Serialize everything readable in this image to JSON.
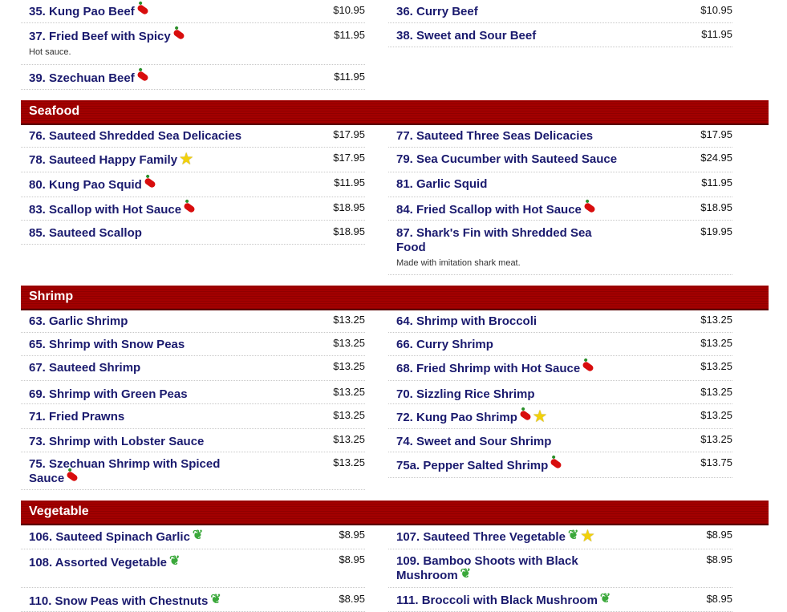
{
  "beef": {
    "items_left": [
      {
        "name": "35. Kung Pao Beef",
        "price": "$10.95",
        "icons": [
          "pepper"
        ],
        "desc": ""
      },
      {
        "name": "37. Fried Beef with Spicy",
        "price": "$11.95",
        "icons": [
          "pepper"
        ],
        "desc": "Hot sauce."
      },
      {
        "name": "39. Szechuan Beef",
        "price": "$11.95",
        "icons": [
          "pepper"
        ],
        "desc": ""
      }
    ],
    "items_right": [
      {
        "name": "36. Curry Beef",
        "price": "$10.95",
        "icons": [],
        "desc": ""
      },
      {
        "name": "38. Sweet and Sour Beef",
        "price": "$11.95",
        "icons": [],
        "desc": ""
      }
    ]
  },
  "seafood": {
    "title": "Seafood",
    "items_left": [
      {
        "name": "76. Sauteed Shredded Sea Delicacies",
        "price": "$17.95",
        "icons": [],
        "desc": ""
      },
      {
        "name": "78. Sauteed Happy Family",
        "price": "$17.95",
        "icons": [
          "star"
        ],
        "desc": ""
      },
      {
        "name": "80. Kung Pao Squid",
        "price": "$11.95",
        "icons": [
          "pepper"
        ],
        "desc": ""
      },
      {
        "name": "83. Scallop with Hot Sauce",
        "price": "$18.95",
        "icons": [
          "pepper"
        ],
        "desc": ""
      },
      {
        "name": "85. Sauteed Scallop",
        "price": "$18.95",
        "icons": [],
        "desc": ""
      }
    ],
    "items_right": [
      {
        "name": "77. Sauteed Three Seas Delicacies",
        "price": "$17.95",
        "icons": [],
        "desc": ""
      },
      {
        "name": "79. Sea Cucumber with Sauteed Sauce",
        "price": "$24.95",
        "icons": [],
        "desc": ""
      },
      {
        "name": "81. Garlic Squid",
        "price": "$11.95",
        "icons": [],
        "desc": ""
      },
      {
        "name": "84. Fried Scallop with Hot Sauce",
        "price": "$18.95",
        "icons": [
          "pepper"
        ],
        "desc": ""
      },
      {
        "name": "87. Shark's Fin with Shredded Sea Food",
        "price": "$19.95",
        "icons": [],
        "desc": "Made with imitation shark meat."
      }
    ]
  },
  "shrimp": {
    "title": "Shrimp",
    "items_left": [
      {
        "name": "63. Garlic Shrimp",
        "price": "$13.25",
        "icons": [],
        "desc": ""
      },
      {
        "name": "65. Shrimp with Snow Peas",
        "price": "$13.25",
        "icons": [],
        "desc": ""
      },
      {
        "name": "67. Sauteed Shrimp",
        "price": "$13.25",
        "icons": [],
        "desc": ""
      },
      {
        "name": "69. Shrimp with Green Peas",
        "price": "$13.25",
        "icons": [],
        "desc": ""
      },
      {
        "name": "71. Fried Prawns",
        "price": "$13.25",
        "icons": [],
        "desc": ""
      },
      {
        "name": "73. Shrimp with Lobster Sauce",
        "price": "$13.25",
        "icons": [],
        "desc": ""
      },
      {
        "name": "75. Szechuan Shrimp with Spiced Sauce",
        "price": "$13.25",
        "icons": [
          "pepper"
        ],
        "desc": ""
      }
    ],
    "items_right": [
      {
        "name": "64. Shrimp with Broccoli",
        "price": "$13.25",
        "icons": [],
        "desc": ""
      },
      {
        "name": "66. Curry Shrimp",
        "price": "$13.25",
        "icons": [],
        "desc": ""
      },
      {
        "name": "68. Fried Shrimp with Hot Sauce",
        "price": "$13.25",
        "icons": [
          "pepper"
        ],
        "desc": ""
      },
      {
        "name": "70. Sizzling Rice Shrimp",
        "price": "$13.25",
        "icons": [],
        "desc": ""
      },
      {
        "name": "72. Kung Pao Shrimp",
        "price": "$13.25",
        "icons": [
          "pepper",
          "star"
        ],
        "desc": ""
      },
      {
        "name": "74. Sweet and Sour Shrimp",
        "price": "$13.25",
        "icons": [],
        "desc": ""
      },
      {
        "name": "75a. Pepper Salted Shrimp",
        "price": "$13.75",
        "icons": [
          "pepper"
        ],
        "desc": ""
      }
    ]
  },
  "vegetable": {
    "title": "Vegetable",
    "items_left": [
      {
        "name": "106. Sauteed Spinach Garlic",
        "price": "$8.95",
        "icons": [
          "veg"
        ],
        "desc": ""
      },
      {
        "name": "108. Assorted Vegetable",
        "price": "$8.95",
        "icons": [
          "veg"
        ],
        "desc": ""
      },
      {
        "name": "110. Snow Peas with Chestnuts",
        "price": "$8.95",
        "icons": [
          "veg"
        ],
        "desc": ""
      }
    ],
    "items_right": [
      {
        "name": "107. Sauteed Three Vegetable",
        "price": "$8.95",
        "icons": [
          "veg",
          "star"
        ],
        "desc": ""
      },
      {
        "name": "109. Bamboo Shoots with Black Mushroom",
        "price": "$8.95",
        "icons": [
          "veg"
        ],
        "desc": ""
      },
      {
        "name": "111. Broccoli with Black Mushroom",
        "price": "$8.95",
        "icons": [
          "veg"
        ],
        "desc": ""
      }
    ]
  },
  "colors": {
    "header_bg": "#a30000",
    "item_text": "#1a1a6e"
  },
  "icon_names": {
    "pepper": "hot-pepper-icon",
    "star": "chef-special-star-icon",
    "veg": "vegetarian-leaf-icon"
  }
}
